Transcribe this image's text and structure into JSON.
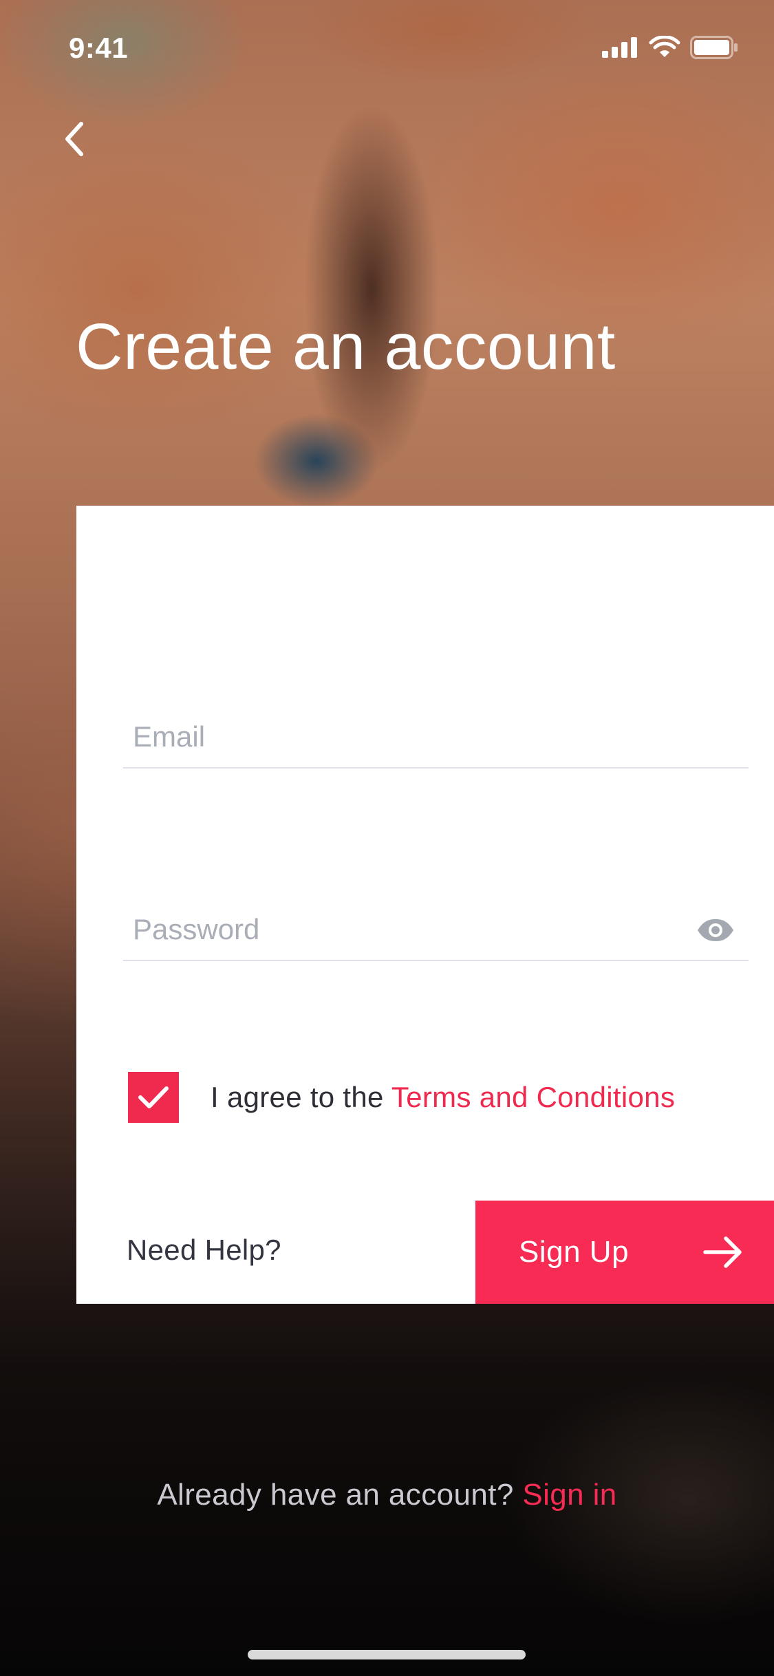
{
  "status_bar": {
    "time": "9:41",
    "icons": [
      "signal-icon",
      "wifi-icon",
      "battery-icon"
    ]
  },
  "nav": {
    "back_icon": "chevron-left-icon"
  },
  "header": {
    "title": "Create an account"
  },
  "form": {
    "email": {
      "value": "",
      "placeholder": "Email"
    },
    "password": {
      "value": "",
      "placeholder": "Password",
      "toggle_icon": "eye-icon"
    },
    "terms": {
      "checked": true,
      "prefix": "I agree to the ",
      "link": "Terms and Conditions"
    },
    "help_label": "Need Help?",
    "submit_label": "Sign Up",
    "submit_icon": "arrow-right-icon"
  },
  "footer": {
    "prompt": "Already have an account? ",
    "link": "Sign in"
  },
  "colors": {
    "accent": "#f72b53",
    "checkbox": "#f0294f",
    "card": "#ffffff",
    "placeholder": "#a9adb6",
    "divider": "#dfe1e6"
  }
}
